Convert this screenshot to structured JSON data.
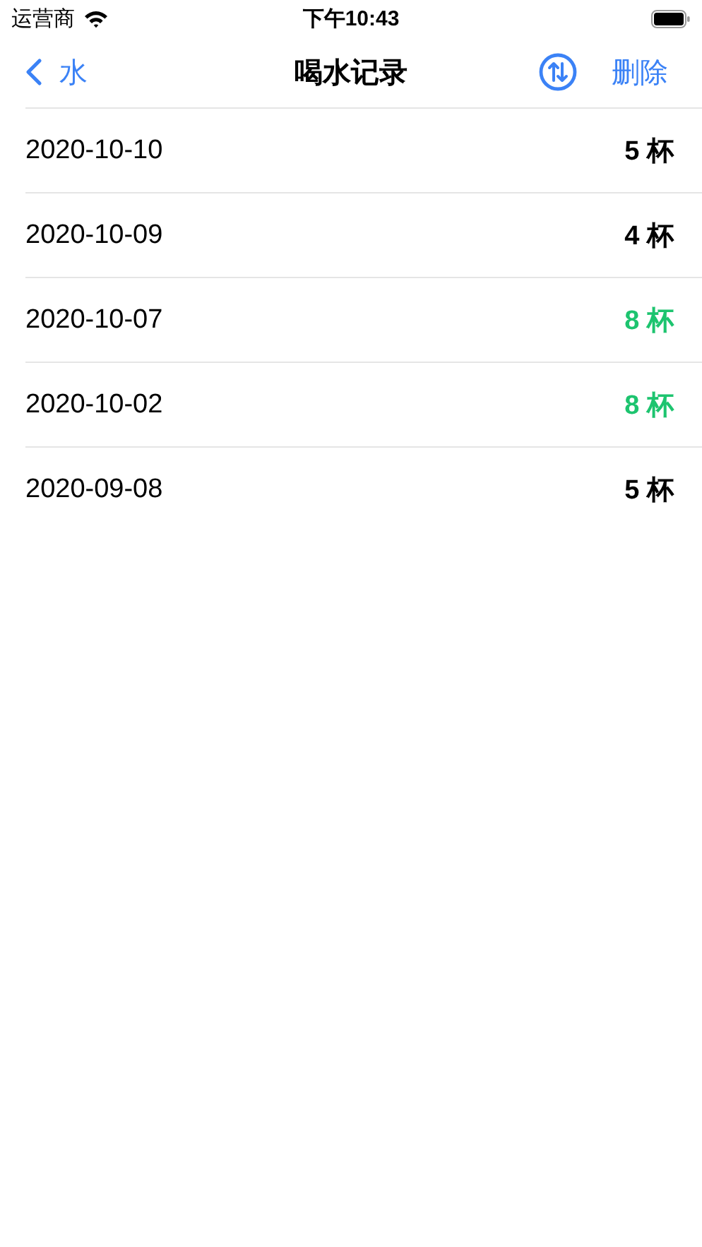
{
  "status_bar": {
    "carrier": "运营商",
    "time": "下午10:43"
  },
  "nav": {
    "back": "水",
    "title": "喝水记录",
    "action": "删除"
  },
  "records": [
    {
      "date": "2020-10-10",
      "count": "5 杯",
      "color": "#000000"
    },
    {
      "date": "2020-10-09",
      "count": "4 杯",
      "color": "#000000"
    },
    {
      "date": "2020-10-07",
      "count": "8 杯",
      "color": "#1dc46f"
    },
    {
      "date": "2020-10-02",
      "count": "8 杯",
      "color": "#1dc46f"
    },
    {
      "date": "2020-09-08",
      "count": "5 杯",
      "color": "#000000"
    }
  ]
}
